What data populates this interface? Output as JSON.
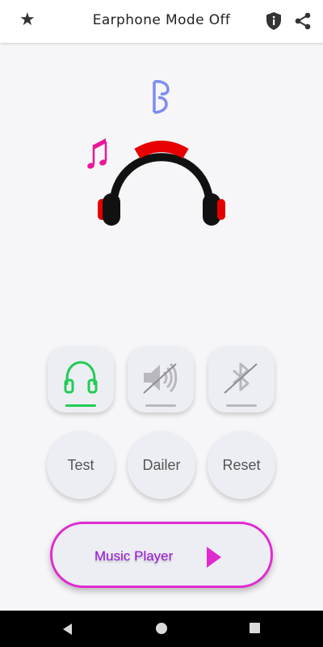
{
  "appbar": {
    "title": "Earphone Mode Off",
    "star_icon": "star-icon",
    "shield_icon": "shield-info-icon",
    "share_icon": "share-icon"
  },
  "scene": {
    "headphone_icon": "headphones-illustration",
    "note_icons": [
      "music-note-icon",
      "music-notes-icon"
    ],
    "colors": {
      "band": "#111111",
      "accent": "#e60000",
      "note_blue": "#7f8cf0",
      "note_pink": "#e8189a"
    }
  },
  "toggles": [
    {
      "name": "headphone-toggle",
      "icon": "headphones-icon",
      "active": true,
      "color": "#22cc55"
    },
    {
      "name": "speaker-toggle",
      "icon": "speaker-off-icon",
      "active": false,
      "color": "#b8b8be"
    },
    {
      "name": "bluetooth-toggle",
      "icon": "bluetooth-off-icon",
      "active": false,
      "color": "#b8b8be"
    }
  ],
  "actions": {
    "test_label": "Test",
    "dailer_label": "Dailer",
    "reset_label": "Reset"
  },
  "music": {
    "label": "Music Player",
    "play_icon": "play-icon",
    "accent": "#e02bd0"
  },
  "navbar": {
    "back_icon": "back-icon",
    "home_icon": "home-icon",
    "recents_icon": "recents-icon"
  }
}
